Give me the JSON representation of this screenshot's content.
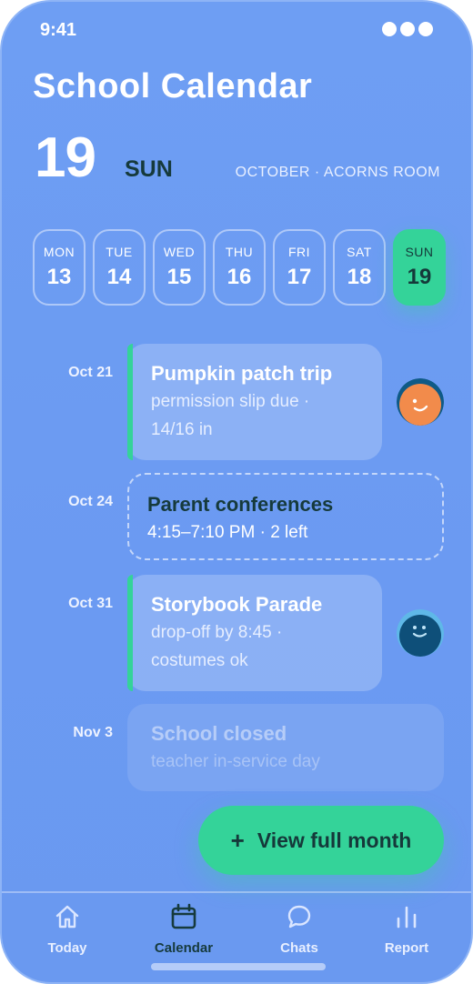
{
  "status": {
    "time": "9:41"
  },
  "title": "School Calendar",
  "today": {
    "day": "19",
    "dow": "SUN",
    "subtitle": "OCTOBER · ACORNS ROOM"
  },
  "week": [
    {
      "dow": "MON",
      "num": "13"
    },
    {
      "dow": "TUE",
      "num": "14"
    },
    {
      "dow": "WED",
      "num": "15"
    },
    {
      "dow": "THU",
      "num": "16"
    },
    {
      "dow": "FRI",
      "num": "17"
    },
    {
      "dow": "SAT",
      "num": "18"
    },
    {
      "dow": "SUN",
      "num": "19"
    }
  ],
  "events": [
    {
      "date": "Oct 21",
      "title": "Pumpkin patch trip",
      "line1": "permission slip due ·",
      "line2": "14/16 in"
    },
    {
      "date": "Oct 24",
      "title": "Parent conferences",
      "line1": "4:15–7:10 PM · 2 left"
    },
    {
      "date": "Oct 31",
      "title": "Storybook Parade",
      "line1": "drop-off by 8:45 ·",
      "line2": "costumes ok"
    },
    {
      "date": "Nov 3",
      "title": "School closed",
      "line1": "teacher in-service day"
    }
  ],
  "cta": {
    "plus": "+",
    "label": "View full month"
  },
  "tabs": [
    {
      "label": "Today",
      "icon": "home-icon"
    },
    {
      "label": "Calendar",
      "icon": "calendar-icon"
    },
    {
      "label": "Chats",
      "icon": "chat-bubble-icon"
    },
    {
      "label": "Report",
      "icon": "bar-chart-icon"
    }
  ],
  "colors": {
    "accent": "#34d399",
    "background": "#6e9ef3",
    "dark_text": "#163a3c"
  }
}
